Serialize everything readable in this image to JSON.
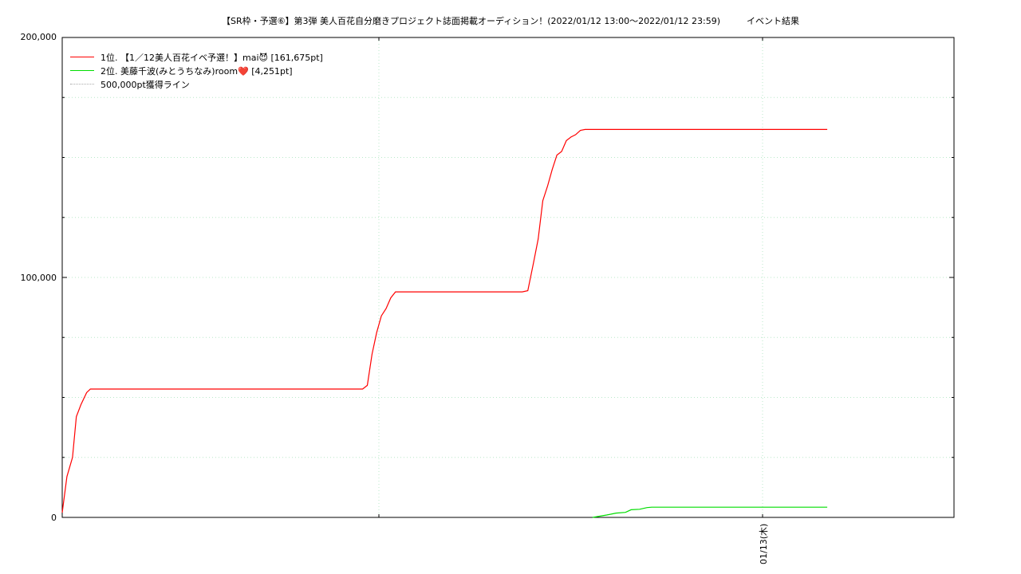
{
  "chart_data": {
    "type": "line",
    "title": "【SR枠・予選⑥】第3弾 美人百花自分磨きプロジェクト誌面掲載オーディション！(2022/01/12 13:00〜2022/01/12 23:59)　　　イベント結果",
    "xlabel": "",
    "ylabel": "",
    "ylim": [
      0,
      200000
    ],
    "x_tick_labels": [
      "01/13(木)"
    ],
    "y_tick_labels": [
      "0",
      "100,000",
      "200,000"
    ],
    "grid": true,
    "legend_position": "top-left",
    "series": [
      {
        "name": "1位. 【1／12美人百花イベ予選！】mai😈 [161,675pt]",
        "color": "#ff0000",
        "points": [
          [
            0.0,
            2000
          ],
          [
            0.5,
            17000
          ],
          [
            1.1,
            25000
          ],
          [
            1.5,
            42000
          ],
          [
            2.0,
            47000
          ],
          [
            2.6,
            52000
          ],
          [
            3.0,
            53500
          ],
          [
            32.0,
            53500
          ],
          [
            32.5,
            55000
          ],
          [
            33.0,
            68000
          ],
          [
            33.5,
            77000
          ],
          [
            34.0,
            84000
          ],
          [
            34.5,
            87000
          ],
          [
            35.0,
            91500
          ],
          [
            35.5,
            94000
          ],
          [
            49.0,
            94000
          ],
          [
            49.6,
            94500
          ],
          [
            50.2,
            106000
          ],
          [
            50.7,
            116000
          ],
          [
            51.2,
            132000
          ],
          [
            51.7,
            138000
          ],
          [
            52.2,
            145000
          ],
          [
            52.7,
            151000
          ],
          [
            53.2,
            152500
          ],
          [
            53.7,
            157000
          ],
          [
            54.2,
            158500
          ],
          [
            54.7,
            159500
          ],
          [
            55.2,
            161300
          ],
          [
            55.7,
            161675
          ],
          [
            81.5,
            161675
          ]
        ]
      },
      {
        "name": "2位. 美藤千波(みとうちなみ)room❤️ [4,251pt]",
        "color": "#00dd00",
        "points": [
          [
            56.5,
            0
          ],
          [
            58.0,
            1000
          ],
          [
            59.0,
            1800
          ],
          [
            60.0,
            2100
          ],
          [
            60.6,
            3200
          ],
          [
            61.5,
            3400
          ],
          [
            62.3,
            4100
          ],
          [
            62.8,
            4251
          ],
          [
            81.5,
            4251
          ]
        ]
      },
      {
        "name": "500,000pt獲得ライン",
        "color": "#aaaaaa",
        "dashed": true,
        "points": []
      }
    ]
  }
}
